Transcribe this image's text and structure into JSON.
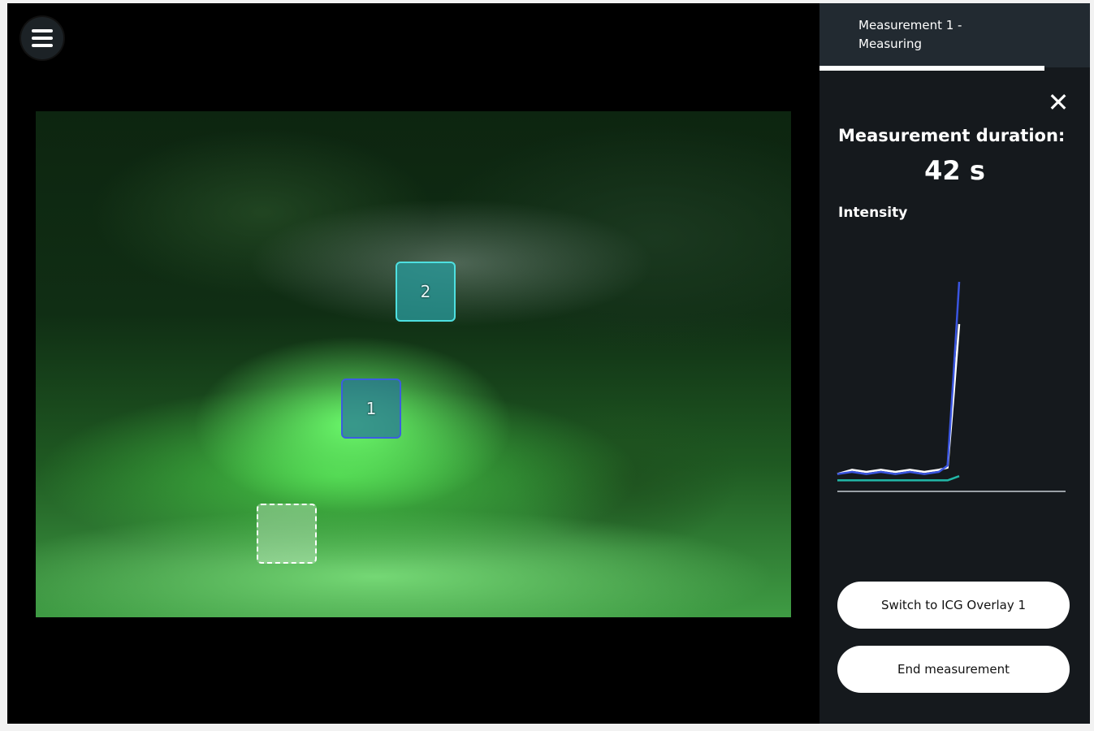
{
  "header": {
    "measurement_title": "Measurement 1 -\nMeasuring"
  },
  "sidebar": {
    "duration_label": "Measurement duration:",
    "duration_value": "42 s",
    "intensity_label": "Intensity",
    "switch_button": "Switch to ICG Overlay 1",
    "end_button": "End measurement"
  },
  "rois": [
    {
      "label": "2",
      "color": "#4ee0e0"
    },
    {
      "label": "1",
      "color": "#3b5de0"
    },
    {
      "label": "",
      "color": "#ffffff"
    }
  ],
  "colors": {
    "sidebar_bg": "#15191d",
    "header_bg": "#222a31",
    "roi_teal": "#4ee0e0",
    "roi_blue": "#3b5de0"
  },
  "icons": {
    "menu": "hamburger-icon",
    "close": "close-icon"
  },
  "chart_data": {
    "type": "line",
    "title": "Intensity",
    "xlabel": "",
    "ylabel": "",
    "x": [
      0,
      5,
      10,
      15,
      20,
      25,
      30,
      35,
      38,
      40,
      42
    ],
    "ylim": [
      0,
      100
    ],
    "series": [
      {
        "color": "#3a55e0",
        "values": [
          4,
          5,
          4,
          5,
          4,
          5,
          4,
          5,
          8,
          50,
          95
        ]
      },
      {
        "color": "#ffffff",
        "values": [
          4,
          6,
          5,
          6,
          5,
          6,
          5,
          6,
          7,
          40,
          75
        ]
      },
      {
        "color": "#22b8a8",
        "values": [
          1,
          1,
          1,
          1,
          1,
          1,
          1,
          1,
          1,
          2,
          3
        ]
      }
    ]
  }
}
